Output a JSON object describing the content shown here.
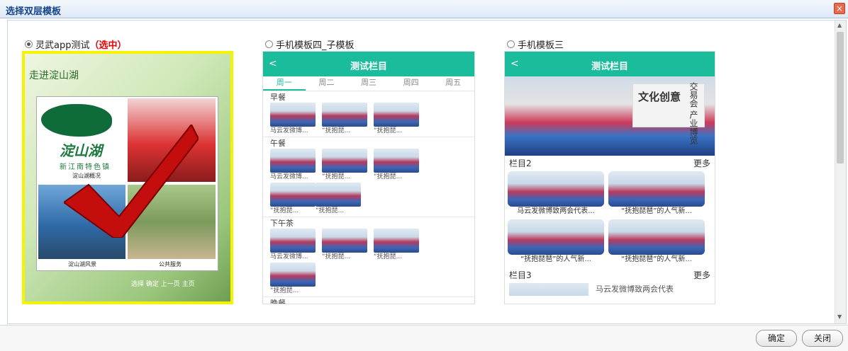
{
  "dialog": {
    "title": "选择双层模板",
    "close_icon": "×"
  },
  "options": [
    {
      "label": "灵武app测试",
      "selected_tag": "（选中）",
      "selected": true
    },
    {
      "label": "手机模板四_子模板",
      "selected": false
    },
    {
      "label": "手机模板三",
      "selected": false
    }
  ],
  "tpl1": {
    "handwritten": "走进淀山湖",
    "logo_name": "淀山湖",
    "logo_sub": "新江南特色镇",
    "cap1": "淀山湖概况",
    "cap2": "淀山湖风景",
    "cap3": "公共服务",
    "footer": "选择 确定 上一页 主页",
    "accent": "#f6f300"
  },
  "tpl2": {
    "back": "<",
    "title": "测试栏目",
    "tabs": [
      "周一",
      "周二",
      "周三",
      "周四",
      "周五"
    ],
    "sections": [
      {
        "heading": "早餐",
        "items": [
          "马云发微博...",
          "“抚抱琵...",
          "“抚抱琵..."
        ]
      },
      {
        "heading": "午餐",
        "items": [
          "马云发微博...",
          "“抚抱琵...",
          "“抚抱琵...",
          "“抚抱琵...",
          "“抚抱琵..."
        ]
      },
      {
        "heading": "下午茶",
        "items": [
          "马云发微博...",
          "“抚抱琵...",
          "“抚抱琵...",
          "“抚抱琵..."
        ]
      },
      {
        "heading": "晚餐",
        "items": [
          "",
          "",
          "",
          ""
        ]
      }
    ],
    "accent": "#1abc9c"
  },
  "tpl3": {
    "back": "<",
    "title": "测试栏目",
    "banner_text": "文化创意",
    "banner_side": "交易会 产业博览",
    "col2": "栏目2",
    "more": "更多",
    "cards": [
      "马云发微博致两会代表...",
      "“抚抱琵琶”的人气新...",
      "“抚抱琵琶”的人气新...",
      "“抚抱琵琶”的人气新..."
    ],
    "col3": "栏目3",
    "item3": "马云发微博致两会代表"
  },
  "buttons": {
    "confirm": "确定",
    "close": "关闭"
  }
}
